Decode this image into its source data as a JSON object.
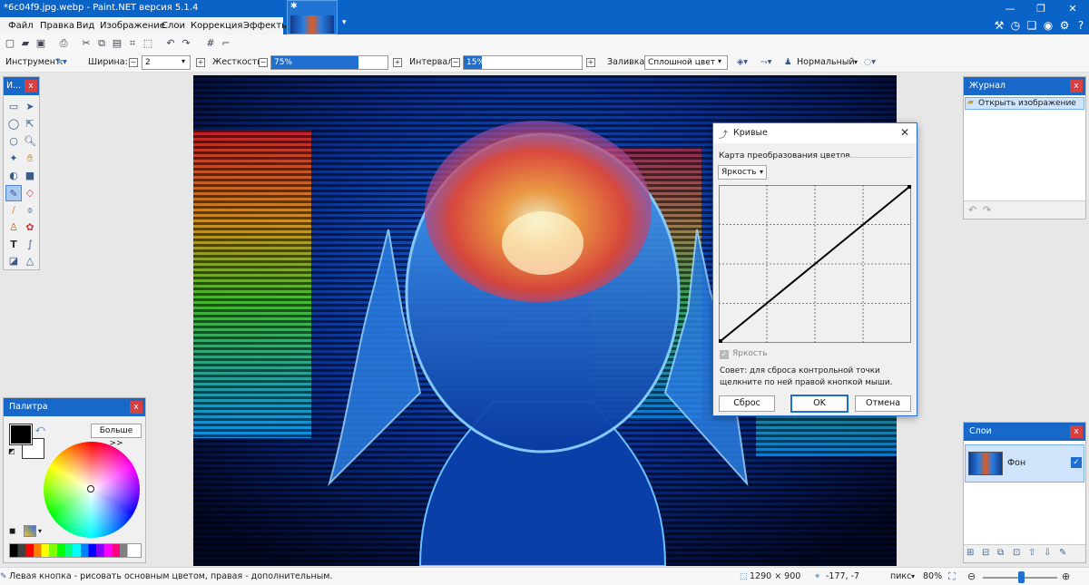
{
  "window": {
    "title": "*6c04f9.jpg.webp - Paint.NET версия 5.1.4",
    "minimize": "—",
    "maximize": "❐",
    "close": "✕"
  },
  "menu": [
    "Файл",
    "Правка",
    "Вид",
    "Изображение",
    "Слои",
    "Коррекция",
    "Эффекты"
  ],
  "options": {
    "tool_label": "Инструмент:",
    "width_label": "Ширина:",
    "width_value": "2",
    "hardness_label": "Жесткость:",
    "hardness_value": "75%",
    "hardness_fraction": 0.75,
    "interval_label": "Интервал:",
    "interval_value": "15%",
    "interval_fraction": 0.15,
    "fill_label": "Заливка:",
    "fill_value": "Сплошной цвет",
    "blend_value": "Нормальный"
  },
  "tools_panel": {
    "title": "И..."
  },
  "palette_panel": {
    "title": "Палитра",
    "more_button": "Больше >>",
    "primary_color": "#000000",
    "secondary_color": "#ffffff"
  },
  "history_panel": {
    "title": "Журнал",
    "items": [
      "Открыть изображение"
    ]
  },
  "layers_panel": {
    "title": "Слои",
    "layers": [
      {
        "name": "Фон",
        "visible": true
      }
    ]
  },
  "curves_dialog": {
    "title": "Кривые",
    "section_label": "Карта преобразования цветов",
    "mode": "Яркость",
    "checkbox_label": "Яркость",
    "hint": "Совет: для сброса контрольной точки щелкните по ней правой кнопкой мыши.",
    "reset_button": "Сброс",
    "ok_button": "OK",
    "cancel_button": "Отмена"
  },
  "status": {
    "text": "Левая кнопка - рисовать основным цветом, правая - дополнительным.",
    "image_size": "1290 × 900",
    "cursor": "-177, -7",
    "units": "пикс",
    "zoom": "80%"
  },
  "colors": {
    "accent": "#0a64c8",
    "panel_header": "#1768c8",
    "close_red": "#d64040"
  }
}
